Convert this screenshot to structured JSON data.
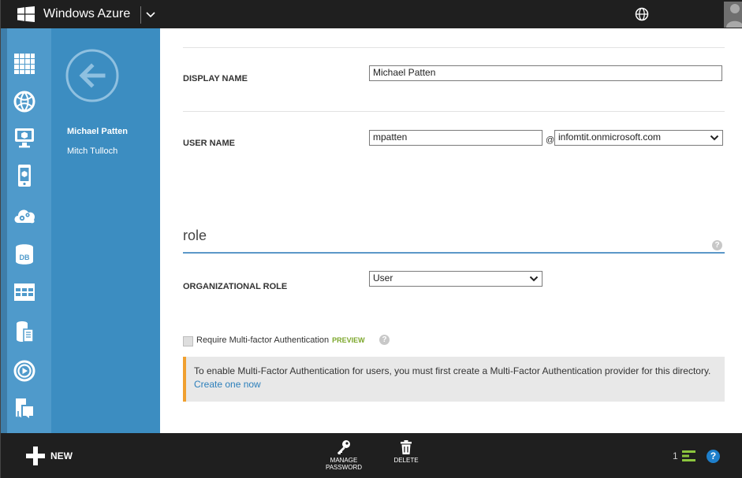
{
  "header": {
    "brand": "Windows Azure"
  },
  "subnav": {
    "items": [
      {
        "label": "Michael Patten"
      },
      {
        "label": "Mitch Tulloch"
      }
    ]
  },
  "form": {
    "display_name_label": "DISPLAY NAME",
    "display_name_value": "Michael Patten",
    "user_name_label": "USER NAME",
    "user_name_value": "mpatten",
    "at_symbol": "@",
    "domain_value": "infomtit.onmicrosoft.com",
    "role_heading": "role",
    "org_role_label": "ORGANIZATIONAL ROLE",
    "org_role_value": "User",
    "mfa_label": "Require Multi-factor Authentication",
    "mfa_preview": "PREVIEW",
    "mfa_notice_text": "To enable Multi-Factor Authentication for users, you must first create a Multi-Factor Authentication provider for this directory.",
    "mfa_notice_link": "Create one now",
    "help_glyph": "?"
  },
  "bottombar": {
    "new_label": "NEW",
    "manage_password_label_line1": "MANAGE",
    "manage_password_label_line2": "PASSWORD",
    "delete_label": "DELETE",
    "progress_count": "1",
    "help_glyph": "?"
  },
  "colors": {
    "topbar": "#1f1f1f",
    "leftnav": "#4f9acb",
    "subnav": "#3c8dc1",
    "accent_line": "#5b98c8",
    "notice_border": "#f0a030",
    "link": "#2c7fbb",
    "preview_green": "#7ba62a",
    "progress_green": "#8cc63e",
    "help_blue": "#1e7fcb"
  },
  "icons": {
    "leftnav": [
      "all-items-grid-icon",
      "web-sites-globe-icon",
      "virtual-machines-icon",
      "mobile-services-icon",
      "cloud-services-icon",
      "sql-databases-icon",
      "storage-table-icon",
      "hdinsight-icon",
      "media-services-icon",
      "import-export-icon"
    ]
  }
}
